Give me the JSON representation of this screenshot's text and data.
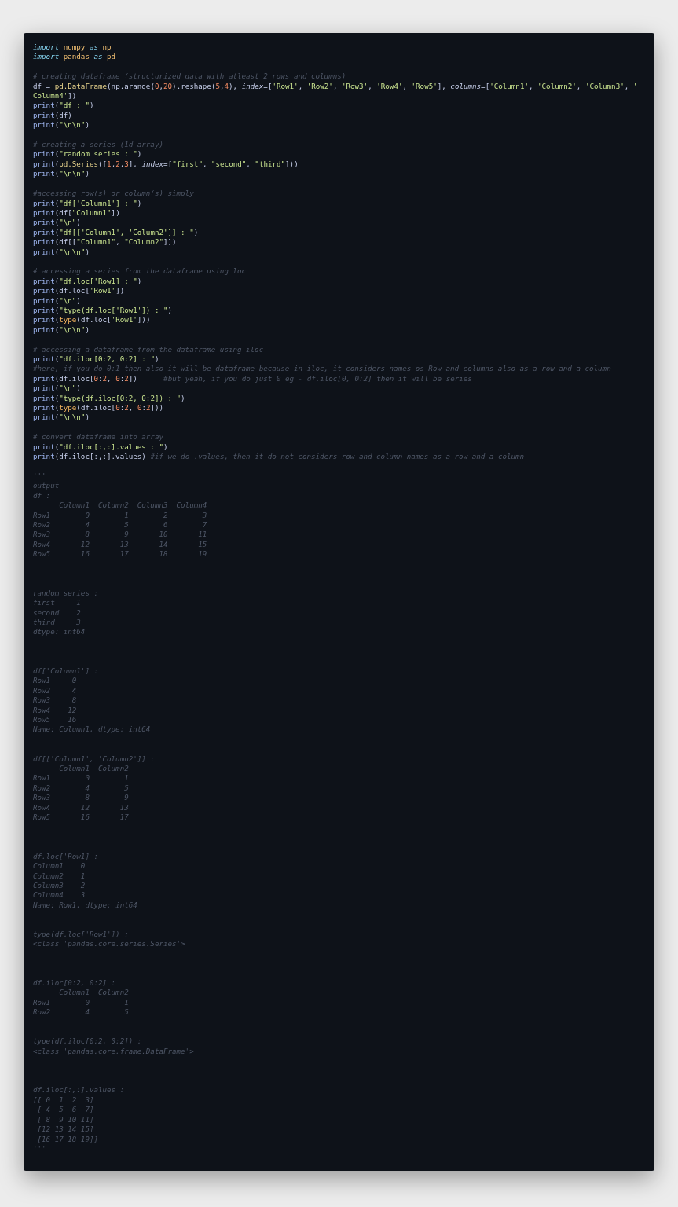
{
  "code_lines": [
    {
      "kind": "code",
      "tokens": [
        {
          "kind": "kw",
          "text": "import"
        },
        {
          "kind": "mod",
          "text": " numpy"
        },
        {
          "kind": "kw",
          "text": " as"
        },
        {
          "kind": "mod",
          "text": " np"
        }
      ]
    },
    {
      "kind": "code",
      "tokens": [
        {
          "kind": "kw",
          "text": "import"
        },
        {
          "kind": "mod",
          "text": " pandas"
        },
        {
          "kind": "kw",
          "text": " as"
        },
        {
          "kind": "mod",
          "text": " pd"
        }
      ]
    },
    {
      "kind": "blank"
    },
    {
      "kind": "code",
      "tokens": [
        {
          "kind": "cm",
          "text": "# creating dataframe (structurized data with atleast 2 rows and columns)"
        }
      ]
    },
    {
      "kind": "code",
      "tokens": [
        {
          "kind": "plain",
          "text": "df = "
        },
        {
          "kind": "call",
          "text": "pd.DataFrame"
        },
        {
          "kind": "plain",
          "text": "(np.arange("
        },
        {
          "kind": "num",
          "text": "0"
        },
        {
          "kind": "plain",
          "text": ","
        },
        {
          "kind": "num",
          "text": "20"
        },
        {
          "kind": "plain",
          "text": ").reshape("
        },
        {
          "kind": "num",
          "text": "5"
        },
        {
          "kind": "plain",
          "text": ","
        },
        {
          "kind": "num",
          "text": "4"
        },
        {
          "kind": "plain",
          "text": "), "
        },
        {
          "kind": "param",
          "text": "index"
        },
        {
          "kind": "plain",
          "text": "=["
        },
        {
          "kind": "str",
          "text": "'Row1'"
        },
        {
          "kind": "plain",
          "text": ", "
        },
        {
          "kind": "str",
          "text": "'Row2'"
        },
        {
          "kind": "plain",
          "text": ", "
        },
        {
          "kind": "str",
          "text": "'Row3'"
        },
        {
          "kind": "plain",
          "text": ", "
        },
        {
          "kind": "str",
          "text": "'Row4'"
        },
        {
          "kind": "plain",
          "text": ", "
        },
        {
          "kind": "str",
          "text": "'Row5'"
        },
        {
          "kind": "plain",
          "text": "], "
        },
        {
          "kind": "param",
          "text": "columns"
        },
        {
          "kind": "plain",
          "text": "=["
        },
        {
          "kind": "str",
          "text": "'Column1'"
        },
        {
          "kind": "plain",
          "text": ", "
        },
        {
          "kind": "str",
          "text": "'Column2'"
        },
        {
          "kind": "plain",
          "text": ", "
        },
        {
          "kind": "str",
          "text": "'Column3'"
        },
        {
          "kind": "plain",
          "text": ", "
        },
        {
          "kind": "str",
          "text": "'"
        }
      ]
    },
    {
      "kind": "code",
      "tokens": [
        {
          "kind": "str",
          "text": "Column4'"
        },
        {
          "kind": "plain",
          "text": "])"
        }
      ]
    },
    {
      "kind": "code",
      "tokens": [
        {
          "kind": "fn",
          "text": "print"
        },
        {
          "kind": "plain",
          "text": "("
        },
        {
          "kind": "str",
          "text": "\"df : \""
        },
        {
          "kind": "plain",
          "text": ")"
        }
      ]
    },
    {
      "kind": "code",
      "tokens": [
        {
          "kind": "fn",
          "text": "print"
        },
        {
          "kind": "plain",
          "text": "(df)"
        }
      ]
    },
    {
      "kind": "code",
      "tokens": [
        {
          "kind": "fn",
          "text": "print"
        },
        {
          "kind": "plain",
          "text": "("
        },
        {
          "kind": "str",
          "text": "\"\\n\\n\""
        },
        {
          "kind": "plain",
          "text": ")"
        }
      ]
    },
    {
      "kind": "blank"
    },
    {
      "kind": "code",
      "tokens": [
        {
          "kind": "cm",
          "text": "# creating a series (1d array)"
        }
      ]
    },
    {
      "kind": "code",
      "tokens": [
        {
          "kind": "fn",
          "text": "print"
        },
        {
          "kind": "plain",
          "text": "("
        },
        {
          "kind": "str",
          "text": "\"random series : \""
        },
        {
          "kind": "plain",
          "text": ")"
        }
      ]
    },
    {
      "kind": "code",
      "tokens": [
        {
          "kind": "fn",
          "text": "print"
        },
        {
          "kind": "plain",
          "text": "("
        },
        {
          "kind": "call",
          "text": "pd.Series"
        },
        {
          "kind": "plain",
          "text": "(["
        },
        {
          "kind": "num",
          "text": "1"
        },
        {
          "kind": "plain",
          "text": ","
        },
        {
          "kind": "num",
          "text": "2"
        },
        {
          "kind": "plain",
          "text": ","
        },
        {
          "kind": "num",
          "text": "3"
        },
        {
          "kind": "plain",
          "text": "], "
        },
        {
          "kind": "param",
          "text": "index"
        },
        {
          "kind": "plain",
          "text": "=["
        },
        {
          "kind": "str",
          "text": "\"first\""
        },
        {
          "kind": "plain",
          "text": ", "
        },
        {
          "kind": "str",
          "text": "\"second\""
        },
        {
          "kind": "plain",
          "text": ", "
        },
        {
          "kind": "str",
          "text": "\"third\""
        },
        {
          "kind": "plain",
          "text": "]))"
        }
      ]
    },
    {
      "kind": "code",
      "tokens": [
        {
          "kind": "fn",
          "text": "print"
        },
        {
          "kind": "plain",
          "text": "("
        },
        {
          "kind": "str",
          "text": "\"\\n\\n\""
        },
        {
          "kind": "plain",
          "text": ")"
        }
      ]
    },
    {
      "kind": "blank"
    },
    {
      "kind": "code",
      "tokens": [
        {
          "kind": "cm",
          "text": "#accessing row(s) or column(s) simply"
        }
      ]
    },
    {
      "kind": "code",
      "tokens": [
        {
          "kind": "fn",
          "text": "print"
        },
        {
          "kind": "plain",
          "text": "("
        },
        {
          "kind": "str",
          "text": "\"df['Column1'] : \""
        },
        {
          "kind": "plain",
          "text": ")"
        }
      ]
    },
    {
      "kind": "code",
      "tokens": [
        {
          "kind": "fn",
          "text": "print"
        },
        {
          "kind": "plain",
          "text": "(df["
        },
        {
          "kind": "str",
          "text": "\"Column1\""
        },
        {
          "kind": "plain",
          "text": "])"
        }
      ]
    },
    {
      "kind": "code",
      "tokens": [
        {
          "kind": "fn",
          "text": "print"
        },
        {
          "kind": "plain",
          "text": "("
        },
        {
          "kind": "str",
          "text": "\"\\n\""
        },
        {
          "kind": "plain",
          "text": ")"
        }
      ]
    },
    {
      "kind": "code",
      "tokens": [
        {
          "kind": "fn",
          "text": "print"
        },
        {
          "kind": "plain",
          "text": "("
        },
        {
          "kind": "str",
          "text": "\"df[['Column1', 'Column2']] : \""
        },
        {
          "kind": "plain",
          "text": ")"
        }
      ]
    },
    {
      "kind": "code",
      "tokens": [
        {
          "kind": "fn",
          "text": "print"
        },
        {
          "kind": "plain",
          "text": "(df[["
        },
        {
          "kind": "str",
          "text": "\"Column1\""
        },
        {
          "kind": "plain",
          "text": ", "
        },
        {
          "kind": "str",
          "text": "\"Column2\""
        },
        {
          "kind": "plain",
          "text": "]])"
        }
      ]
    },
    {
      "kind": "code",
      "tokens": [
        {
          "kind": "fn",
          "text": "print"
        },
        {
          "kind": "plain",
          "text": "("
        },
        {
          "kind": "str",
          "text": "\"\\n\\n\""
        },
        {
          "kind": "plain",
          "text": ")"
        }
      ]
    },
    {
      "kind": "blank"
    },
    {
      "kind": "code",
      "tokens": [
        {
          "kind": "cm",
          "text": "# accessing a series from the dataframe using loc"
        }
      ]
    },
    {
      "kind": "code",
      "tokens": [
        {
          "kind": "fn",
          "text": "print"
        },
        {
          "kind": "plain",
          "text": "("
        },
        {
          "kind": "str",
          "text": "\"df.loc['Row1] : \""
        },
        {
          "kind": "plain",
          "text": ")"
        }
      ]
    },
    {
      "kind": "code",
      "tokens": [
        {
          "kind": "fn",
          "text": "print"
        },
        {
          "kind": "plain",
          "text": "(df.loc["
        },
        {
          "kind": "str",
          "text": "'Row1'"
        },
        {
          "kind": "plain",
          "text": "])"
        }
      ]
    },
    {
      "kind": "code",
      "tokens": [
        {
          "kind": "fn",
          "text": "print"
        },
        {
          "kind": "plain",
          "text": "("
        },
        {
          "kind": "str",
          "text": "\"\\n\""
        },
        {
          "kind": "plain",
          "text": ")"
        }
      ]
    },
    {
      "kind": "code",
      "tokens": [
        {
          "kind": "fn",
          "text": "print"
        },
        {
          "kind": "plain",
          "text": "("
        },
        {
          "kind": "str",
          "text": "\"type(df.loc['Row1']) : \""
        },
        {
          "kind": "plain",
          "text": ")"
        }
      ]
    },
    {
      "kind": "code",
      "tokens": [
        {
          "kind": "fn",
          "text": "print"
        },
        {
          "kind": "plain",
          "text": "("
        },
        {
          "kind": "builtin",
          "text": "type"
        },
        {
          "kind": "plain",
          "text": "(df.loc["
        },
        {
          "kind": "str",
          "text": "'Row1'"
        },
        {
          "kind": "plain",
          "text": "]))"
        }
      ]
    },
    {
      "kind": "code",
      "tokens": [
        {
          "kind": "fn",
          "text": "print"
        },
        {
          "kind": "plain",
          "text": "("
        },
        {
          "kind": "str",
          "text": "\"\\n\\n\""
        },
        {
          "kind": "plain",
          "text": ")"
        }
      ]
    },
    {
      "kind": "blank"
    },
    {
      "kind": "code",
      "tokens": [
        {
          "kind": "cm",
          "text": "# accessing a dataframe from the dataframe using iloc"
        }
      ]
    },
    {
      "kind": "code",
      "tokens": [
        {
          "kind": "fn",
          "text": "print"
        },
        {
          "kind": "plain",
          "text": "("
        },
        {
          "kind": "str",
          "text": "\"df.iloc[0:2, 0:2] : \""
        },
        {
          "kind": "plain",
          "text": ")"
        }
      ]
    },
    {
      "kind": "code",
      "tokens": [
        {
          "kind": "cm",
          "text": "#here, if you do 0:1 then also it will be dataframe because in iloc, it considers names os Row and columns also as a row and a column"
        }
      ]
    },
    {
      "kind": "code",
      "tokens": [
        {
          "kind": "fn",
          "text": "print"
        },
        {
          "kind": "plain",
          "text": "(df.iloc["
        },
        {
          "kind": "num",
          "text": "0"
        },
        {
          "kind": "plain",
          "text": ":"
        },
        {
          "kind": "num",
          "text": "2"
        },
        {
          "kind": "plain",
          "text": ", "
        },
        {
          "kind": "num",
          "text": "0"
        },
        {
          "kind": "plain",
          "text": ":"
        },
        {
          "kind": "num",
          "text": "2"
        },
        {
          "kind": "plain",
          "text": "])      "
        },
        {
          "kind": "cm",
          "text": "#but yeah, if you do just 0 eg - df.iloc[0, 0:2] then it will be series"
        }
      ]
    },
    {
      "kind": "code",
      "tokens": [
        {
          "kind": "fn",
          "text": "print"
        },
        {
          "kind": "plain",
          "text": "("
        },
        {
          "kind": "str",
          "text": "\"\\n\""
        },
        {
          "kind": "plain",
          "text": ")"
        }
      ]
    },
    {
      "kind": "code",
      "tokens": [
        {
          "kind": "fn",
          "text": "print"
        },
        {
          "kind": "plain",
          "text": "("
        },
        {
          "kind": "str",
          "text": "\"type(df.iloc[0:2, 0:2]) : \""
        },
        {
          "kind": "plain",
          "text": ")"
        }
      ]
    },
    {
      "kind": "code",
      "tokens": [
        {
          "kind": "fn",
          "text": "print"
        },
        {
          "kind": "plain",
          "text": "("
        },
        {
          "kind": "builtin",
          "text": "type"
        },
        {
          "kind": "plain",
          "text": "(df.iloc["
        },
        {
          "kind": "num",
          "text": "0"
        },
        {
          "kind": "plain",
          "text": ":"
        },
        {
          "kind": "num",
          "text": "2"
        },
        {
          "kind": "plain",
          "text": ", "
        },
        {
          "kind": "num",
          "text": "0"
        },
        {
          "kind": "plain",
          "text": ":"
        },
        {
          "kind": "num",
          "text": "2"
        },
        {
          "kind": "plain",
          "text": "]))"
        }
      ]
    },
    {
      "kind": "code",
      "tokens": [
        {
          "kind": "fn",
          "text": "print"
        },
        {
          "kind": "plain",
          "text": "("
        },
        {
          "kind": "str",
          "text": "\"\\n\\n\""
        },
        {
          "kind": "plain",
          "text": ")"
        }
      ]
    },
    {
      "kind": "blank"
    },
    {
      "kind": "code",
      "tokens": [
        {
          "kind": "cm",
          "text": "# convert dataframe into array"
        }
      ]
    },
    {
      "kind": "code",
      "tokens": [
        {
          "kind": "fn",
          "text": "print"
        },
        {
          "kind": "plain",
          "text": "("
        },
        {
          "kind": "str",
          "text": "\"df.iloc[:,:].values : \""
        },
        {
          "kind": "plain",
          "text": ")"
        }
      ]
    },
    {
      "kind": "code",
      "tokens": [
        {
          "kind": "fn",
          "text": "print"
        },
        {
          "kind": "plain",
          "text": "(df.iloc[:,:].values) "
        },
        {
          "kind": "cm",
          "text": "#if we do .values, then it do not considers row and column names as a row and a column"
        }
      ]
    },
    {
      "kind": "blank"
    },
    {
      "kind": "output",
      "text": "'''"
    },
    {
      "kind": "output",
      "text": "output --"
    },
    {
      "kind": "output",
      "text": "df :"
    },
    {
      "kind": "output",
      "text": "      Column1  Column2  Column3  Column4"
    },
    {
      "kind": "output",
      "text": "Row1        0        1        2        3"
    },
    {
      "kind": "output",
      "text": "Row2        4        5        6        7"
    },
    {
      "kind": "output",
      "text": "Row3        8        9       10       11"
    },
    {
      "kind": "output",
      "text": "Row4       12       13       14       15"
    },
    {
      "kind": "output",
      "text": "Row5       16       17       18       19"
    },
    {
      "kind": "blank"
    },
    {
      "kind": "blank"
    },
    {
      "kind": "blank"
    },
    {
      "kind": "output",
      "text": "random series :"
    },
    {
      "kind": "output",
      "text": "first     1"
    },
    {
      "kind": "output",
      "text": "second    2"
    },
    {
      "kind": "output",
      "text": "third     3"
    },
    {
      "kind": "output",
      "text": "dtype: int64"
    },
    {
      "kind": "blank"
    },
    {
      "kind": "blank"
    },
    {
      "kind": "blank"
    },
    {
      "kind": "output",
      "text": "df['Column1'] :"
    },
    {
      "kind": "output",
      "text": "Row1     0"
    },
    {
      "kind": "output",
      "text": "Row2     4"
    },
    {
      "kind": "output",
      "text": "Row3     8"
    },
    {
      "kind": "output",
      "text": "Row4    12"
    },
    {
      "kind": "output",
      "text": "Row5    16"
    },
    {
      "kind": "output",
      "text": "Name: Column1, dtype: int64"
    },
    {
      "kind": "blank"
    },
    {
      "kind": "blank"
    },
    {
      "kind": "output",
      "text": "df[['Column1', 'Column2']] :"
    },
    {
      "kind": "output",
      "text": "      Column1  Column2"
    },
    {
      "kind": "output",
      "text": "Row1        0        1"
    },
    {
      "kind": "output",
      "text": "Row2        4        5"
    },
    {
      "kind": "output",
      "text": "Row3        8        9"
    },
    {
      "kind": "output",
      "text": "Row4       12       13"
    },
    {
      "kind": "output",
      "text": "Row5       16       17"
    },
    {
      "kind": "blank"
    },
    {
      "kind": "blank"
    },
    {
      "kind": "blank"
    },
    {
      "kind": "output",
      "text": "df.loc['Row1] :"
    },
    {
      "kind": "output",
      "text": "Column1    0"
    },
    {
      "kind": "output",
      "text": "Column2    1"
    },
    {
      "kind": "output",
      "text": "Column3    2"
    },
    {
      "kind": "output",
      "text": "Column4    3"
    },
    {
      "kind": "output",
      "text": "Name: Row1, dtype: int64"
    },
    {
      "kind": "blank"
    },
    {
      "kind": "blank"
    },
    {
      "kind": "output",
      "text": "type(df.loc['Row1']) :"
    },
    {
      "kind": "output",
      "text": "<class 'pandas.core.series.Series'>"
    },
    {
      "kind": "blank"
    },
    {
      "kind": "blank"
    },
    {
      "kind": "blank"
    },
    {
      "kind": "output",
      "text": "df.iloc[0:2, 0:2] :"
    },
    {
      "kind": "output",
      "text": "      Column1  Column2"
    },
    {
      "kind": "output",
      "text": "Row1        0        1"
    },
    {
      "kind": "output",
      "text": "Row2        4        5"
    },
    {
      "kind": "blank"
    },
    {
      "kind": "blank"
    },
    {
      "kind": "output",
      "text": "type(df.iloc[0:2, 0:2]) :"
    },
    {
      "kind": "output",
      "text": "<class 'pandas.core.frame.DataFrame'>"
    },
    {
      "kind": "blank"
    },
    {
      "kind": "blank"
    },
    {
      "kind": "blank"
    },
    {
      "kind": "output",
      "text": "df.iloc[:,:].values :"
    },
    {
      "kind": "output",
      "text": "[[ 0  1  2  3]"
    },
    {
      "kind": "output",
      "text": " [ 4  5  6  7]"
    },
    {
      "kind": "output",
      "text": " [ 8  9 10 11]"
    },
    {
      "kind": "output",
      "text": " [12 13 14 15]"
    },
    {
      "kind": "output",
      "text": " [16 17 18 19]]"
    },
    {
      "kind": "output",
      "text": "'''"
    }
  ]
}
